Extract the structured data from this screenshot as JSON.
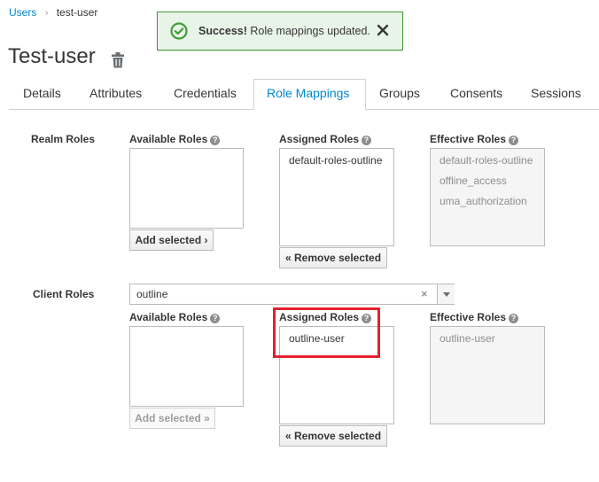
{
  "breadcrumb": {
    "parent": "Users",
    "separator": "›",
    "current": "test-user"
  },
  "toast": {
    "strong": "Success!",
    "message": " Role mappings updated.",
    "status_color": "#3f9c35"
  },
  "page": {
    "title": "Test-user"
  },
  "tabs": [
    {
      "label": "Details"
    },
    {
      "label": "Attributes"
    },
    {
      "label": "Credentials"
    },
    {
      "label": "Role Mappings",
      "active": true
    },
    {
      "label": "Groups"
    },
    {
      "label": "Consents"
    },
    {
      "label": "Sessions"
    }
  ],
  "realm_roles": {
    "label": "Realm Roles",
    "available": {
      "heading": "Available Roles",
      "items": [],
      "button": "Add selected ›"
    },
    "assigned": {
      "heading": "Assigned Roles",
      "items": [
        "default-roles-outline"
      ],
      "button": "« Remove selected"
    },
    "effective": {
      "heading": "Effective Roles",
      "items": [
        "default-roles-outline",
        "offline_access",
        "uma_authorization"
      ]
    }
  },
  "client_roles": {
    "label": "Client Roles",
    "client_select": {
      "value": "outline",
      "clear": "×"
    },
    "available": {
      "heading": "Available Roles",
      "items": [],
      "button": "Add selected »"
    },
    "assigned": {
      "heading": "Assigned Roles",
      "items": [
        "outline-user"
      ],
      "button": "« Remove selected"
    },
    "effective": {
      "heading": "Effective Roles",
      "items": [
        "outline-user"
      ]
    }
  },
  "help_icon": "?",
  "colors": {
    "link": "#0088ce",
    "highlight": "#e3212b"
  }
}
